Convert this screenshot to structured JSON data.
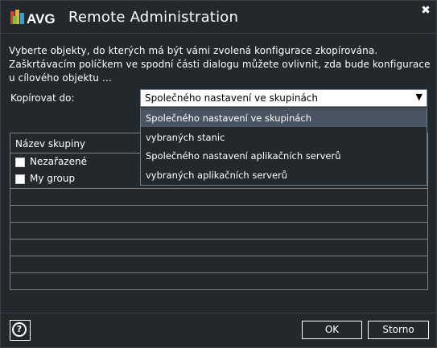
{
  "titlebar": {
    "logo_text": "AVG",
    "title": "Remote Administration",
    "close_label": "✖"
  },
  "dialog": {
    "description": "Vyberte objekty, do kterých má být vámi zvolená konfigurace zkopírována. Zaškrtávacím políčkem ve spodní části dialogu můžete ovlivnit, zda bude konfigurace u cílového objektu …"
  },
  "copy_to": {
    "label": "Kopírovat do:",
    "selected_value": "Společného nastavení ve skupinách",
    "arrow": "▼",
    "options": [
      "Společného nastavení ve skupinách",
      "vybraných stanic",
      "Společného nastavení aplikačních serverů",
      "vybraných aplikačních serverů"
    ]
  },
  "table": {
    "header": "Název skupiny",
    "rows": [
      {
        "label": "Nezařazené",
        "checked": false
      },
      {
        "label": "My group",
        "checked": false
      }
    ]
  },
  "footer": {
    "help_label": "?",
    "ok_label": "OK",
    "cancel_label": "Storno"
  },
  "colors": {
    "background": "#23282c",
    "selected_option": "#495562",
    "border": "#7a8288"
  }
}
